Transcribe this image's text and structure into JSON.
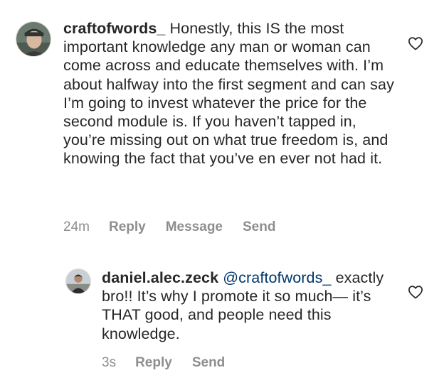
{
  "comments": [
    {
      "username": "craftofwords_",
      "text": " Honestly, this IS the most important knowledge any man or woman can come across and educate themselves with. I’m about halfway into the first segment and can say I’m going to invest whatever the price for the second module is. If you haven’t tapped in, you’re missing out on what true freedom is, and knowing the fact that you’ve en ever not had it.",
      "time": "24m",
      "actions": [
        "Reply",
        "Message",
        "Send"
      ],
      "like_icon": "heart-outline-icon"
    },
    {
      "username": "daniel.alec.zeck",
      "mention": "@craftofwords_",
      "text": "exactly bro!! It’s why I promote it so much— it’s THAT good, and people need this knowledge.",
      "time": "3s",
      "actions": [
        "Reply",
        "Send"
      ],
      "like_icon": "heart-outline-icon"
    }
  ],
  "colors": {
    "text": "#262626",
    "meta": "#8e8e8e",
    "mention": "#00376b",
    "background": "#ffffff"
  }
}
